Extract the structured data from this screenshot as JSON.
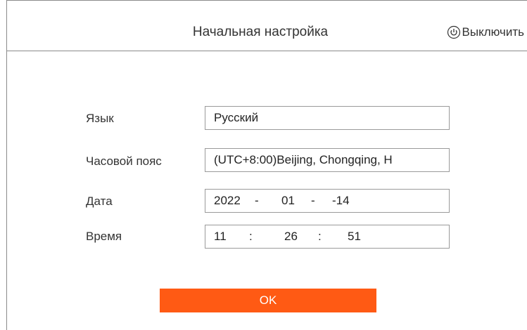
{
  "header": {
    "title": "Начальная настройка",
    "shutdown_label": "Выключить",
    "shutdown_icon": "power-icon"
  },
  "form": {
    "language": {
      "label": "Язык",
      "value": "Русский"
    },
    "timezone": {
      "label": "Часовой пояс",
      "value": "(UTC+8:00)Beijing, Chongqing, H"
    },
    "date": {
      "label": "Дата",
      "year": "2022",
      "sep1": "-",
      "month": "01",
      "sep2": "-",
      "day": "-14"
    },
    "time": {
      "label": "Время",
      "hour": "11",
      "sep1": ":",
      "minute": "26",
      "sep2": ":",
      "second": "51"
    }
  },
  "ok_label": "OK",
  "colors": {
    "accent": "#ff5a14",
    "border": "#8a8a8a",
    "text": "#333333"
  }
}
